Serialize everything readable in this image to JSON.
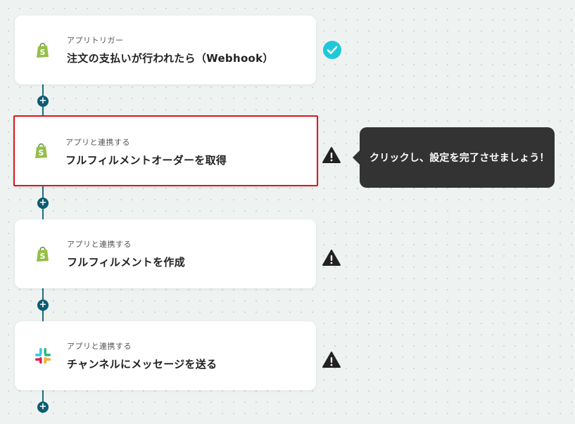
{
  "steps": [
    {
      "subtitle": "アプリトリガー",
      "title": "注文の支払いが行われたら（Webhook）",
      "app_icon": "shopify-icon",
      "status": "completed"
    },
    {
      "subtitle": "アプリと連携する",
      "title": "フルフィルメントオーダーを取得",
      "app_icon": "shopify-icon",
      "status": "warning"
    },
    {
      "subtitle": "アプリと連携する",
      "title": "フルフィルメントを作成",
      "app_icon": "shopify-icon",
      "status": "warning"
    },
    {
      "subtitle": "アプリと連携する",
      "title": "チャンネルにメッセージを送る",
      "app_icon": "slack-icon",
      "status": "warning"
    }
  ],
  "add_button_glyph": "+",
  "tooltip": {
    "text": "クリックし、設定を完了させましょう！"
  },
  "colors": {
    "accent": "#0d5c73",
    "check": "#1ec8d8",
    "warning": "#222222",
    "selected_border": "#e0141c",
    "tooltip_bg": "#333333",
    "shopify_green": "#95bf47"
  }
}
